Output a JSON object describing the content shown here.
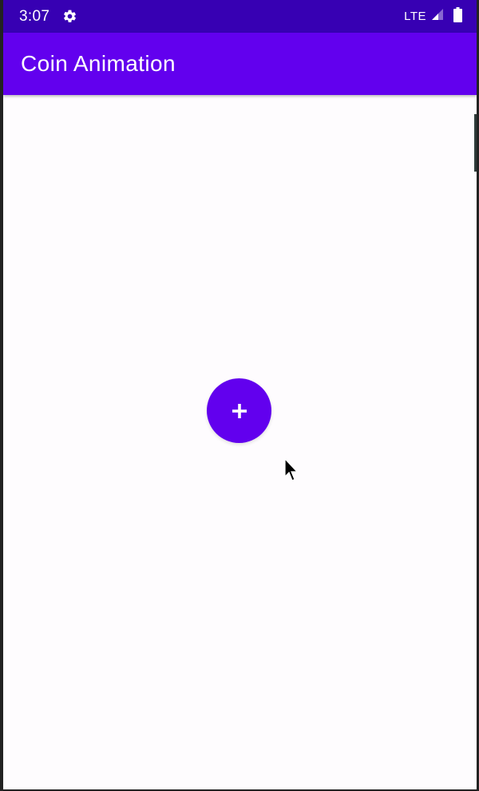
{
  "status_bar": {
    "time": "3:07",
    "network": "LTE",
    "icons": [
      "settings-gear-icon",
      "signal-icon",
      "battery-icon"
    ]
  },
  "app_bar": {
    "title": "Coin Animation"
  },
  "fab": {
    "icon": "plus-icon"
  },
  "colors": {
    "status_bar": "#3700b3",
    "primary": "#6200ee",
    "background": "#fefcfe"
  }
}
